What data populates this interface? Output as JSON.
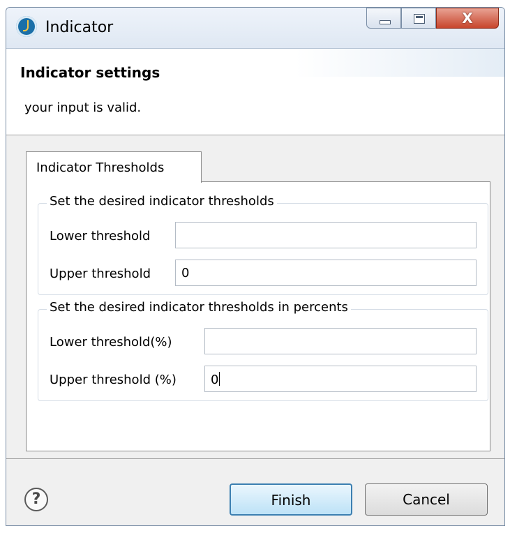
{
  "window": {
    "title": "Indicator",
    "close_glyph": "X"
  },
  "header": {
    "title": "Indicator settings",
    "message": "your input is valid."
  },
  "tabs": [
    {
      "label": "Indicator Thresholds"
    }
  ],
  "groups": [
    {
      "title": "Set the desired indicator thresholds",
      "fields": [
        {
          "label": "Lower threshold",
          "value": ""
        },
        {
          "label": "Upper threshold",
          "value": "0"
        }
      ]
    },
    {
      "title": "Set the desired indicator thresholds in percents",
      "fields": [
        {
          "label": "Lower threshold(%)",
          "value": ""
        },
        {
          "label": "Upper threshold (%)",
          "value": "0"
        }
      ]
    }
  ],
  "footer": {
    "help_symbol": "?",
    "finish_label": "Finish",
    "cancel_label": "Cancel"
  }
}
